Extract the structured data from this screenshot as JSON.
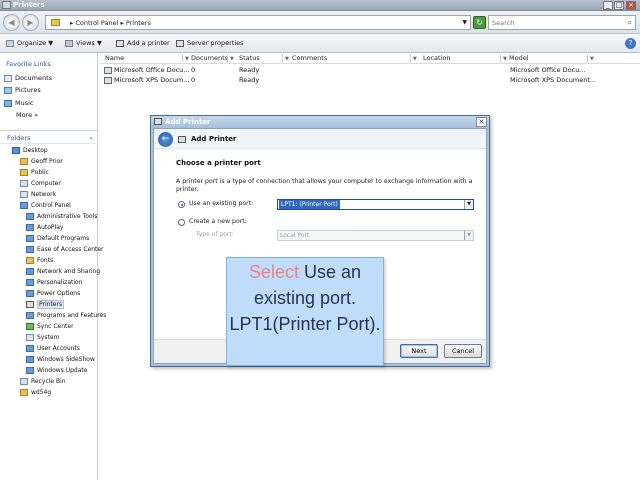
{
  "window": {
    "title": "Printers",
    "min_label": "_",
    "max_label": "□",
    "close_label": "×"
  },
  "address": {
    "crumbs": "▸ Control Panel ▸ Printers",
    "dropdown": "▼",
    "search_placeholder": "Search"
  },
  "toolbar": {
    "organize": "Organize ▼",
    "views": "Views ▼",
    "add_printer": "Add a printer",
    "server_properties": "Server properties",
    "help": "?"
  },
  "favorites": {
    "title": "Favorite Links",
    "items": [
      "Documents",
      "Pictures",
      "Music",
      "More »"
    ]
  },
  "folders": {
    "title": "Folders",
    "chevron": "⌄",
    "tree": [
      "Desktop",
      "Geoff Prior",
      "Public",
      "Computer",
      "Network",
      "Control Panel",
      "Administrative Tools",
      "AutoPlay",
      "Default Programs",
      "Ease of Access Center",
      "Fonts",
      "Network and Sharing",
      "Personalization",
      "Power Options",
      "Printers",
      "Programs and Features",
      "Sync Center",
      "System",
      "User Accounts",
      "Windows SideShow",
      "Windows Update",
      "Recycle Bin",
      "wd54g"
    ]
  },
  "list": {
    "columns": [
      "Name",
      "Documents",
      "Status",
      "Comments",
      "Location",
      "Model"
    ],
    "rows": [
      [
        "Microsoft Office Docu...",
        "0",
        "Ready",
        "",
        "",
        "Microsoft Office Docu..."
      ],
      [
        "Microsoft XPS Docum...",
        "0",
        "Ready",
        "",
        "",
        "Microsoft XPS Document..."
      ]
    ]
  },
  "dialog": {
    "title": "Add Printer",
    "close": "×",
    "header": "Add Printer",
    "back": "←",
    "section_title": "Choose a printer port",
    "description": "A printer port is a type of connection that allows your computer to exchange information with a printer.",
    "use_existing_label": "Use an existing port:",
    "use_existing_value": "LPT1: (Printer Port)",
    "create_new_label": "Create a new port:",
    "type_label": "Type of port:",
    "type_value": "Local Port",
    "next": "Next",
    "cancel": "Cancel"
  },
  "callout": {
    "highlight": "Select",
    "text": " Use an existing port. LPT1(Printer Port)."
  },
  "colors": {
    "accent": "#3266c0",
    "callout_bg": "#bfdcfb",
    "callout_highlight": "#f07f85"
  }
}
